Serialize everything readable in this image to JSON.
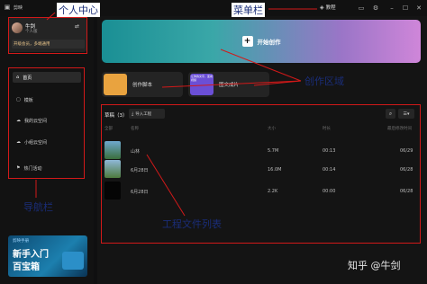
{
  "titlebar": {
    "app_name": "剪映",
    "tutorial_label": "教程"
  },
  "profile": {
    "name": "牛剑",
    "subtitle": "个人版",
    "promo": "开级会员，多端通用"
  },
  "nav": {
    "items": [
      {
        "label": "首页"
      },
      {
        "label": "模板"
      },
      {
        "label": "我的云空间"
      },
      {
        "label": "小组云空间"
      },
      {
        "label": "热门活动"
      }
    ]
  },
  "banner": {
    "line1": "新手入门",
    "line2": "百宝箱",
    "tag": "剪映手册"
  },
  "create": {
    "start_label": "开始创作",
    "card1": "创作脚本",
    "card2": "图文成片",
    "card2_thumb_text": "让你的文字，变成视频"
  },
  "drafts": {
    "title": "草稿（3）",
    "import_label": "导入工程",
    "headers": {
      "select": "全部",
      "name": "名称",
      "size": "大小",
      "duration": "时长",
      "modified": "最后修改时间"
    },
    "rows": [
      {
        "name": "山林",
        "size": "5.7M",
        "duration": "00:13",
        "date": "06/29"
      },
      {
        "name": "6月28日",
        "size": "16.0M",
        "duration": "00:14",
        "date": "06/28"
      },
      {
        "name": "6月28日",
        "size": "2.2K",
        "duration": "00:00",
        "date": "06/28"
      }
    ]
  },
  "annotations": {
    "personal_center": "个人中心",
    "menu_bar": "菜单栏",
    "create_area": "创作区域",
    "nav_bar": "导航栏",
    "project_list": "工程文件列表",
    "watermark": "知乎 @牛剑"
  },
  "colors": {
    "annotation_red": "#d21919",
    "annotation_text": "#1a2d78",
    "gradient_start": "#1a8f94",
    "gradient_end": "#cf86d9"
  }
}
